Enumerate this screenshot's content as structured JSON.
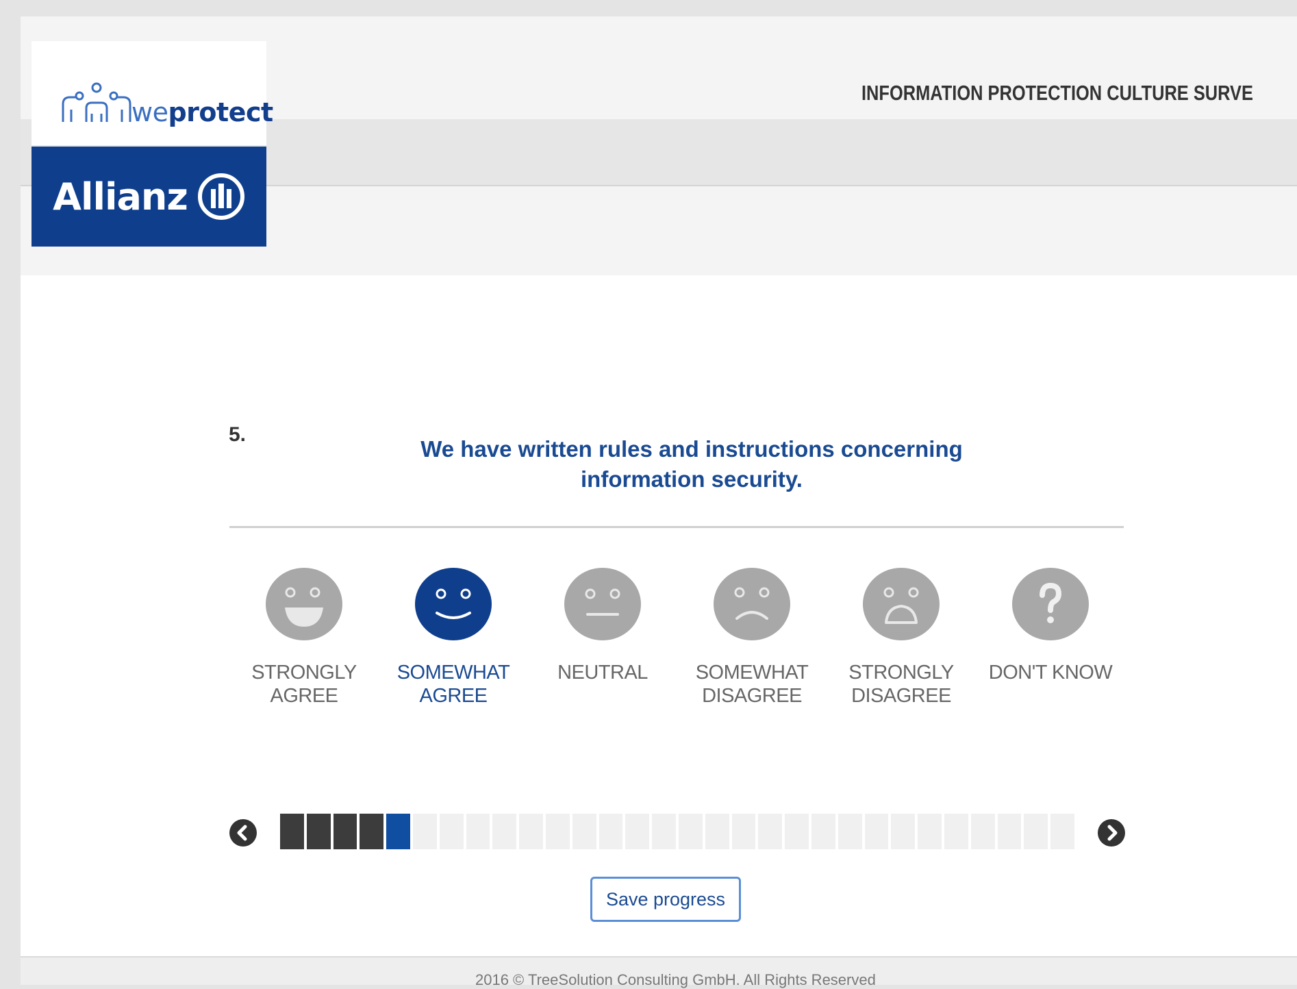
{
  "header": {
    "logo_brand_light": "we",
    "logo_brand_bold": "protect",
    "partner_logo": "Allianz",
    "survey_title": "INFORMATION PROTECTION CULTURE SURVE"
  },
  "question": {
    "number": "5.",
    "text": "We have written rules and instructions concerning information security."
  },
  "options": [
    {
      "label": "STRONGLY AGREE",
      "icon": "strongly-agree-face-icon",
      "selected": false
    },
    {
      "label": "SOMEWHAT AGREE",
      "icon": "somewhat-agree-face-icon",
      "selected": true
    },
    {
      "label": "NEUTRAL",
      "icon": "neutral-face-icon",
      "selected": false
    },
    {
      "label": "SOMEWHAT DISAGREE",
      "icon": "somewhat-disagree-face-icon",
      "selected": false
    },
    {
      "label": "STRONGLY DISAGREE",
      "icon": "strongly-disagree-face-icon",
      "selected": false
    },
    {
      "label": "DON'T KNOW",
      "icon": "question-mark-icon",
      "selected": false
    }
  ],
  "progress": {
    "current_question": 5,
    "answered_fraction": 0.17,
    "prev_icon": "chevron-left-icon",
    "next_icon": "chevron-right-icon"
  },
  "actions": {
    "save_label": "Save progress"
  },
  "footer": {
    "text": "2016 © TreeSolution Consulting GmbH. All Rights Reserved"
  },
  "colors": {
    "brand_blue": "#0f3f8c",
    "text_blue": "#1a4a92",
    "face_gray": "#a8a8a8",
    "progress_done": "#3c3c3c"
  }
}
